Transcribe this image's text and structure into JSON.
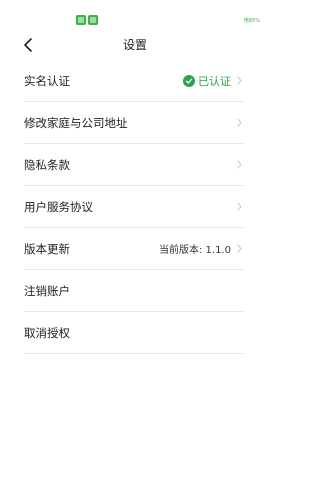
{
  "status_bar": {
    "battery_text": "电85%",
    "icons": [
      "app-notification-icon",
      "app-notification-icon"
    ]
  },
  "nav": {
    "title": "设置",
    "back_icon": "chevron-left-icon"
  },
  "menu": {
    "items": [
      {
        "label": "实名认证",
        "status": "已认证",
        "status_icon": "check-circle-icon"
      },
      {
        "label": "修改家庭与公司地址"
      },
      {
        "label": "隐私条款"
      },
      {
        "label": "用户服务协议"
      },
      {
        "label": "版本更新",
        "value": "当前版本: 1.1.0"
      },
      {
        "label": "注销账户"
      },
      {
        "label": "取消授权"
      }
    ]
  },
  "colors": {
    "accent_green": "#2fa34a",
    "divider": "#e9e9e9",
    "chevron": "#c8c8c8"
  }
}
